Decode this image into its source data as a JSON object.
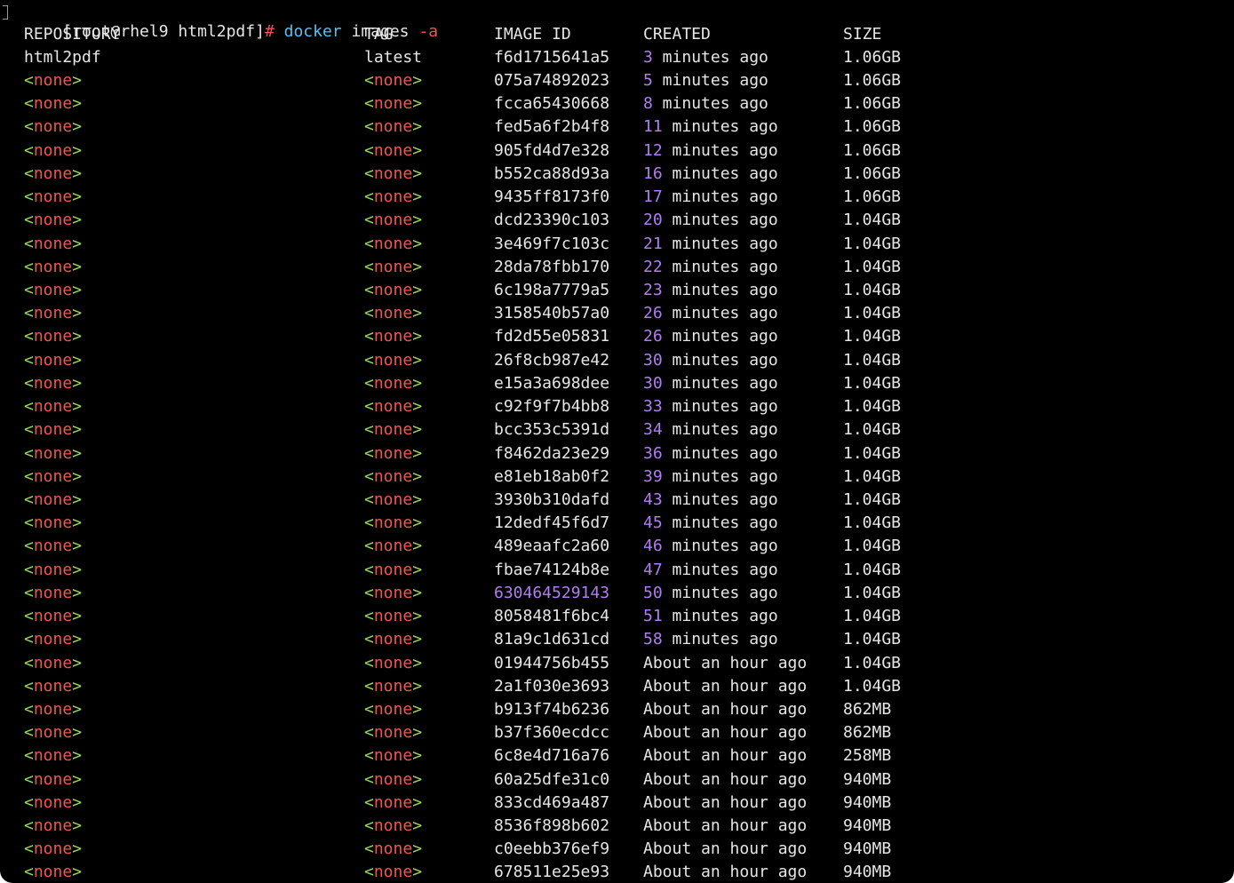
{
  "prompt": {
    "user_host": "[root@rhel9 html2pdf]",
    "hash": "#",
    "command": "docker",
    "args": "images",
    "flag": "-a"
  },
  "headers": {
    "repository": "REPOSITORY",
    "tag": "TAG",
    "image_id": "IMAGE ID",
    "created": "CREATED",
    "size": "SIZE"
  },
  "none_label": {
    "open": "<",
    "word": "none",
    "close": ">"
  },
  "first_row": {
    "repository": "html2pdf",
    "tag": "latest",
    "id": "f6d1715641a5",
    "num": "3",
    "created_rest": " minutes ago",
    "size": "1.06GB"
  },
  "rows": [
    {
      "id": "075a74892023",
      "num": "5",
      "c": " minutes ago",
      "s": "1.06GB"
    },
    {
      "id": "fcca65430668",
      "num": "8",
      "c": " minutes ago",
      "s": "1.06GB"
    },
    {
      "id": "fed5a6f2b4f8",
      "num": "11",
      "c": " minutes ago",
      "s": "1.06GB"
    },
    {
      "id": "905fd4d7e328",
      "num": "12",
      "c": " minutes ago",
      "s": "1.06GB"
    },
    {
      "id": "b552ca88d93a",
      "num": "16",
      "c": " minutes ago",
      "s": "1.06GB"
    },
    {
      "id": "9435ff8173f0",
      "num": "17",
      "c": " minutes ago",
      "s": "1.06GB"
    },
    {
      "id": "dcd23390c103",
      "num": "20",
      "c": " minutes ago",
      "s": "1.04GB"
    },
    {
      "id": "3e469f7c103c",
      "num": "21",
      "c": " minutes ago",
      "s": "1.04GB"
    },
    {
      "id": "28da78fbb170",
      "num": "22",
      "c": " minutes ago",
      "s": "1.04GB"
    },
    {
      "id": "6c198a7779a5",
      "num": "23",
      "c": " minutes ago",
      "s": "1.04GB"
    },
    {
      "id": "3158540b57a0",
      "num": "26",
      "c": " minutes ago",
      "s": "1.04GB"
    },
    {
      "id": "fd2d55e05831",
      "num": "26",
      "c": " minutes ago",
      "s": "1.04GB"
    },
    {
      "id": "26f8cb987e42",
      "num": "30",
      "c": " minutes ago",
      "s": "1.04GB"
    },
    {
      "id": "e15a3a698dee",
      "num": "30",
      "c": " minutes ago",
      "s": "1.04GB"
    },
    {
      "id": "c92f9f7b4bb8",
      "num": "33",
      "c": " minutes ago",
      "s": "1.04GB"
    },
    {
      "id": "bcc353c5391d",
      "num": "34",
      "c": " minutes ago",
      "s": "1.04GB"
    },
    {
      "id": "f8462da23e29",
      "num": "36",
      "c": " minutes ago",
      "s": "1.04GB"
    },
    {
      "id": "e81eb18ab0f2",
      "num": "39",
      "c": " minutes ago",
      "s": "1.04GB"
    },
    {
      "id": "3930b310dafd",
      "num": "43",
      "c": " minutes ago",
      "s": "1.04GB"
    },
    {
      "id": "12dedf45f6d7",
      "num": "45",
      "c": " minutes ago",
      "s": "1.04GB"
    },
    {
      "id": "489eaafc2a60",
      "num": "46",
      "c": " minutes ago",
      "s": "1.04GB"
    },
    {
      "id": "fbae74124b8e",
      "num": "47",
      "c": " minutes ago",
      "s": "1.04GB"
    },
    {
      "id": "630464529143",
      "num": "50",
      "c": " minutes ago",
      "s": "1.04GB",
      "purple_id": true
    },
    {
      "id": "8058481f6bc4",
      "num": "51",
      "c": " minutes ago",
      "s": "1.04GB"
    },
    {
      "id": "81a9c1d631cd",
      "num": "58",
      "c": " minutes ago",
      "s": "1.04GB"
    },
    {
      "id": "01944756b455",
      "c": "About an hour ago",
      "s": "1.04GB"
    },
    {
      "id": "2a1f030e3693",
      "c": "About an hour ago",
      "s": "1.04GB"
    },
    {
      "id": "b913f74b6236",
      "c": "About an hour ago",
      "s": "862MB"
    },
    {
      "id": "b37f360ecdcc",
      "c": "About an hour ago",
      "s": "862MB"
    },
    {
      "id": "6c8e4d716a76",
      "c": "About an hour ago",
      "s": "258MB"
    },
    {
      "id": "60a25dfe31c0",
      "c": "About an hour ago",
      "s": "940MB"
    },
    {
      "id": "833cd469a487",
      "c": "About an hour ago",
      "s": "940MB"
    },
    {
      "id": "8536f898b602",
      "c": "About an hour ago",
      "s": "940MB"
    },
    {
      "id": "c0eebb376ef9",
      "c": "About an hour ago",
      "s": "940MB"
    },
    {
      "id": "678511e25e93",
      "c": "About an hour ago",
      "s": "940MB"
    }
  ],
  "colors": {
    "background": "#000000",
    "text": "#e6e6e6",
    "none_bracket": "#98d85b",
    "none_word": "#f0564f",
    "number": "#b07ef0",
    "command": "#56c1f0"
  }
}
